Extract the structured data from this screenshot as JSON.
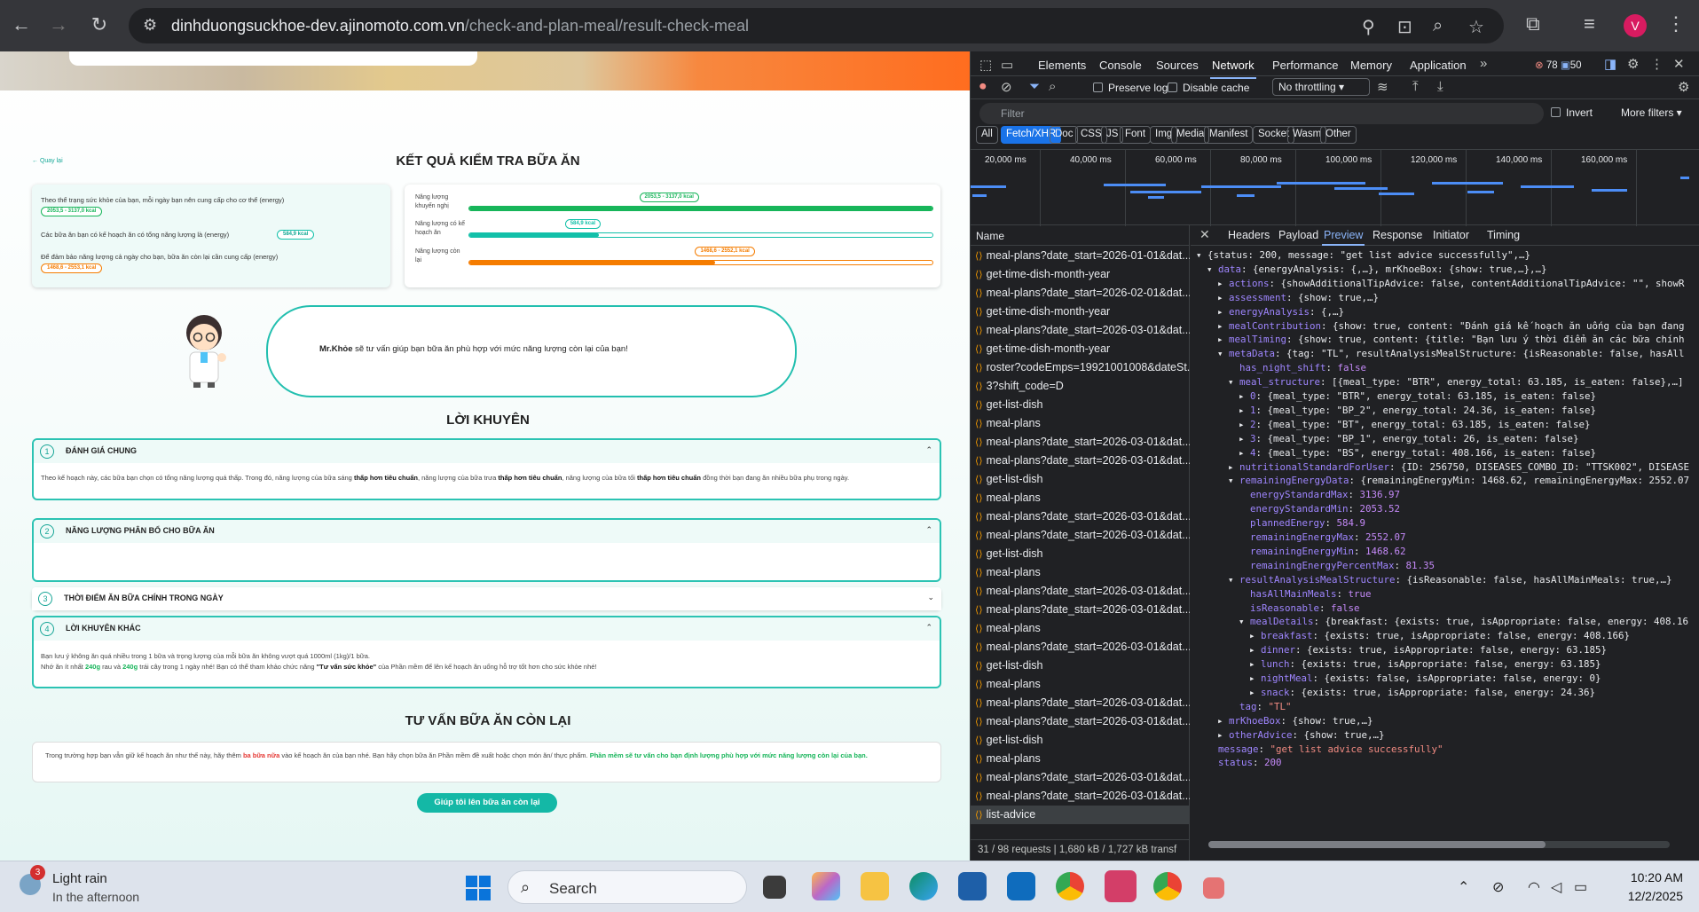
{
  "browser": {
    "url_host": "dinhduongsuckhoe-dev.ajinomoto.com.vn",
    "url_path": "/check-and-plan-meal/result-check-meal",
    "avatar_letter": "V"
  },
  "page": {
    "back_label": "Quay lại",
    "title": "KẾT QUẢ KIỂM TRA BỮA ĂN",
    "energy_summary": {
      "line1": "Theo thể trạng sức khỏe của bạn, mỗi ngày bạn nên cung cấp cho cơ thể (energy)",
      "line1_value": "2053,5 - 3137,0 kcal",
      "line2": "Các bữa ăn bạn có kế hoạch ăn có tổng năng lượng là (energy)",
      "line2_value": "584,9 kcal",
      "line3": "Để đảm bảo năng lượng cả ngày cho bạn, bữa ăn còn lại cần cung cấp (energy)",
      "line3_value": "1468,6 - 2553,1 kcal"
    },
    "energy_bars": [
      {
        "label": "Năng lượng khuyến nghị",
        "value_label": "2053,5 - 3137,0 kcal",
        "fill_fraction": 1.0,
        "color": "#17b55a"
      },
      {
        "label": "Năng lượng có kế hoạch ăn",
        "value_label": "584,9 kcal",
        "fill_fraction": 0.28,
        "color": "#12c0a9"
      },
      {
        "label": "Năng lượng còn lại",
        "value_label": "1468,6 - 2552,1 kcal",
        "fill_fraction": 0.53,
        "color": "#f57c00"
      }
    ],
    "mrkhoe": {
      "name": "Mr.Khỏe",
      "text": " sẽ tư vấn giúp bạn bữa ăn phù hợp với mức năng lượng còn lại của bạn!"
    },
    "advice_title": "LỜI KHUYÊN",
    "sections": [
      {
        "num": "1",
        "title": "ĐÁNH GIÁ CHUNG",
        "chevron": "⌃"
      },
      {
        "num": "2",
        "title": "NĂNG LƯỢNG PHÂN BỔ CHO BỮA ĂN",
        "chevron": "⌃"
      },
      {
        "num": "3",
        "title": "THỜI ĐIỂM ĂN BỮA CHÍNH TRONG NGÀY",
        "chevron": "⌄"
      },
      {
        "num": "4",
        "title": "LỜI KHUYÊN KHÁC",
        "chevron": "⌃"
      }
    ],
    "assessment": {
      "p1": "Theo kế hoạch này, các bữa bạn chọn có tổng năng lượng quá thấp. Trong đó, năng lượng của bữa sáng ",
      "b1": "thấp hơn tiêu chuẩn",
      "p2": ", năng lượng của bữa trưa ",
      "b2": "thấp hơn tiêu chuẩn",
      "p3": ", năng lượng của bữa tối ",
      "b3": "thấp hơn tiêu chuẩn",
      "p4": " đồng thời bạn đang ăn nhiều bữa phụ trong ngày."
    },
    "other_advice": {
      "line1": "Bạn lưu ý không ăn quá nhiều trong 1 bữa và trọng lượng của mỗi bữa ăn không vượt quá 1000ml (1kg)/1 bữa.",
      "l2a": "Nhớ ăn ít nhất ",
      "l2b": "240g",
      "l2c": " rau và ",
      "l2d": "240g",
      "l2e": " trái cây trong 1 ngày nhé! Bạn có thể tham khảo chức năng ",
      "l2f": "\"Tư vấn sức khỏe\"",
      "l2g": " của Phần mềm để lên kế hoạch ăn uống hỗ trợ tốt hơn cho sức khỏe nhé!"
    },
    "remain_title": "TƯ VẤN BỮA ĂN CÒN LẠI",
    "remain": {
      "a": "Trong trường hợp bạn vẫn giữ kế hoạch ăn như thế này, hãy thêm ",
      "b": "ba bữa nữa",
      "c": " vào kế hoạch ăn của bạn nhé. Bạn hãy chọn bữa ăn Phần mềm đề xuất hoặc chọn món ăn/ thực phẩm. ",
      "d": "Phần mềm sẽ tư vấn cho bạn định lượng phù hợp với mức năng lượng còn lại của bạn."
    },
    "help_button": "Giúp tôi lên bữa ăn còn lại"
  },
  "devtools": {
    "tabs": [
      "Elements",
      "Console",
      "Sources",
      "Network",
      "Performance",
      "Memory",
      "Application"
    ],
    "active_tab": "Network",
    "errors": "78",
    "warnings": "50",
    "preserve_log": "Preserve log",
    "disable_cache": "Disable cache",
    "throttling": "No throttling",
    "filter_placeholder": "Filter",
    "invert": "Invert",
    "more_filters": "More filters",
    "types": [
      "All",
      "Fetch/XHR",
      "Doc",
      "CSS",
      "JS",
      "Font",
      "Img",
      "Media",
      "Manifest",
      "Socket",
      "Wasm",
      "Other"
    ],
    "active_type": "Fetch/XHR",
    "timeline_ticks": [
      "20,000 ms",
      "40,000 ms",
      "60,000 ms",
      "80,000 ms",
      "100,000 ms",
      "120,000 ms",
      "140,000 ms",
      "160,000 ms"
    ],
    "name_header": "Name",
    "requests": [
      "meal-plans?date_start=2026-01-01&dat...",
      "get-time-dish-month-year",
      "meal-plans?date_start=2026-02-01&dat...",
      "get-time-dish-month-year",
      "meal-plans?date_start=2026-03-01&dat...",
      "get-time-dish-month-year",
      "roster?codeEmps=19921001008&dateSt...",
      "3?shift_code=D",
      "get-list-dish",
      "meal-plans",
      "meal-plans?date_start=2026-03-01&dat...",
      "meal-plans?date_start=2026-03-01&dat...",
      "get-list-dish",
      "meal-plans",
      "meal-plans?date_start=2026-03-01&dat...",
      "meal-plans?date_start=2026-03-01&dat...",
      "get-list-dish",
      "meal-plans",
      "meal-plans?date_start=2026-03-01&dat...",
      "meal-plans?date_start=2026-03-01&dat...",
      "meal-plans",
      "meal-plans?date_start=2026-03-01&dat...",
      "get-list-dish",
      "meal-plans",
      "meal-plans?date_start=2026-03-01&dat...",
      "meal-plans?date_start=2026-03-01&dat...",
      "get-list-dish",
      "meal-plans",
      "meal-plans?date_start=2026-03-01&dat...",
      "meal-plans?date_start=2026-03-01&dat...",
      "list-advice"
    ],
    "status_bar": "31 / 98 requests | 1,680 kB / 1,727 kB transf",
    "detail_tabs": [
      "Headers",
      "Payload",
      "Preview",
      "Response",
      "Initiator",
      "Timing"
    ],
    "active_detail_tab": "Preview",
    "preview_lines": [
      {
        "indent": 0,
        "arrow": "▾",
        "text": "{status: 200, message: \"get list advice successfully\",…}"
      },
      {
        "indent": 1,
        "arrow": "▾",
        "key": "data",
        "text": ": {energyAnalysis: {,…}, mrKhoeBox: {show: true,…},…}"
      },
      {
        "indent": 2,
        "arrow": "▸",
        "key": "actions",
        "text": ": {showAdditionalTipAdvice: false, contentAdditionalTipAdvice: \"\", showR"
      },
      {
        "indent": 2,
        "arrow": "▸",
        "key": "assessment",
        "text": ": {show: true,…}"
      },
      {
        "indent": 2,
        "arrow": "▸",
        "key": "energyAnalysis",
        "text": ": {,…}"
      },
      {
        "indent": 2,
        "arrow": "▸",
        "key": "mealContribution",
        "text": ": {show: true, content: \"Đánh giá kế hoạch ăn uống của bạn đang"
      },
      {
        "indent": 2,
        "arrow": "▸",
        "key": "mealTiming",
        "text": ": {show: true, content: {title: \"Bạn lưu ý thời điểm ăn các bữa chính"
      },
      {
        "indent": 2,
        "arrow": "▾",
        "key": "metaData",
        "text": ": {tag: \"TL\", resultAnalysisMealStructure: {isReasonable: false, hasAll"
      },
      {
        "indent": 3,
        "arrow": "",
        "key": "has_night_shift",
        "text": ": ",
        "val": "false"
      },
      {
        "indent": 3,
        "arrow": "▾",
        "key": "meal_structure",
        "text": ": [{meal_type: \"BTR\", energy_total: 63.185, is_eaten: false},…]"
      },
      {
        "indent": 4,
        "arrow": "▸",
        "key": "0",
        "text": ": {meal_type: \"BTR\", energy_total: 63.185, is_eaten: false}"
      },
      {
        "indent": 4,
        "arrow": "▸",
        "key": "1",
        "text": ": {meal_type: \"BP_2\", energy_total: 24.36, is_eaten: false}"
      },
      {
        "indent": 4,
        "arrow": "▸",
        "key": "2",
        "text": ": {meal_type: \"BT\", energy_total: 63.185, is_eaten: false}"
      },
      {
        "indent": 4,
        "arrow": "▸",
        "key": "3",
        "text": ": {meal_type: \"BP_1\", energy_total: 26, is_eaten: false}"
      },
      {
        "indent": 4,
        "arrow": "▸",
        "key": "4",
        "text": ": {meal_type: \"BS\", energy_total: 408.166, is_eaten: false}"
      },
      {
        "indent": 3,
        "arrow": "▸",
        "key": "nutritionalStandardForUser",
        "text": ": {ID: 256750, DISEASES_COMBO_ID: \"TTSK002\", DISEASE"
      },
      {
        "indent": 3,
        "arrow": "▾",
        "key": "remainingEnergyData",
        "text": ": {remainingEnergyMin: 1468.62, remainingEnergyMax: 2552.07"
      },
      {
        "indent": 4,
        "arrow": "",
        "key": "energyStandardMax",
        "text": ": ",
        "val": "3136.97"
      },
      {
        "indent": 4,
        "arrow": "",
        "key": "energyStandardMin",
        "text": ": ",
        "val": "2053.52"
      },
      {
        "indent": 4,
        "arrow": "",
        "key": "plannedEnergy",
        "text": ": ",
        "val": "584.9"
      },
      {
        "indent": 4,
        "arrow": "",
        "key": "remainingEnergyMax",
        "text": ": ",
        "val": "2552.07"
      },
      {
        "indent": 4,
        "arrow": "",
        "key": "remainingEnergyMin",
        "text": ": ",
        "val": "1468.62"
      },
      {
        "indent": 4,
        "arrow": "",
        "key": "remainingEnergyPercentMax",
        "text": ": ",
        "val": "81.35"
      },
      {
        "indent": 3,
        "arrow": "▾",
        "key": "resultAnalysisMealStructure",
        "text": ": {isReasonable: false, hasAllMainMeals: true,…}"
      },
      {
        "indent": 4,
        "arrow": "",
        "key": "hasAllMainMeals",
        "text": ": ",
        "val": "true"
      },
      {
        "indent": 4,
        "arrow": "",
        "key": "isReasonable",
        "text": ": ",
        "val": "false"
      },
      {
        "indent": 4,
        "arrow": "▾",
        "key": "mealDetails",
        "text": ": {breakfast: {exists: true, isAppropriate: false, energy: 408.16"
      },
      {
        "indent": 5,
        "arrow": "▸",
        "key": "breakfast",
        "text": ": {exists: true, isAppropriate: false, energy: 408.166}"
      },
      {
        "indent": 5,
        "arrow": "▸",
        "key": "dinner",
        "text": ": {exists: true, isAppropriate: false, energy: 63.185}"
      },
      {
        "indent": 5,
        "arrow": "▸",
        "key": "lunch",
        "text": ": {exists: true, isAppropriate: false, energy: 63.185}"
      },
      {
        "indent": 5,
        "arrow": "▸",
        "key": "nightMeal",
        "text": ": {exists: false, isAppropriate: false, energy: 0}"
      },
      {
        "indent": 5,
        "arrow": "▸",
        "key": "snack",
        "text": ": {exists: true, isAppropriate: false, energy: 24.36}"
      },
      {
        "indent": 3,
        "arrow": "",
        "key": "tag",
        "text": ": ",
        "sval": "\"TL\""
      },
      {
        "indent": 2,
        "arrow": "▸",
        "key": "mrKhoeBox",
        "text": ": {show: true,…}"
      },
      {
        "indent": 2,
        "arrow": "▸",
        "key": "otherAdvice",
        "text": ": {show: true,…}"
      },
      {
        "indent": 1,
        "arrow": "",
        "key": "message",
        "text": ": ",
        "sval": "\"get list advice successfully\""
      },
      {
        "indent": 1,
        "arrow": "",
        "key": "status",
        "text": ": ",
        "val": "200"
      }
    ]
  },
  "taskbar": {
    "weather_badge": "3",
    "weather_title": "Light rain",
    "weather_sub": "In the afternoon",
    "search_label": "Search",
    "time": "10:20 AM",
    "date": "12/2/2025"
  }
}
